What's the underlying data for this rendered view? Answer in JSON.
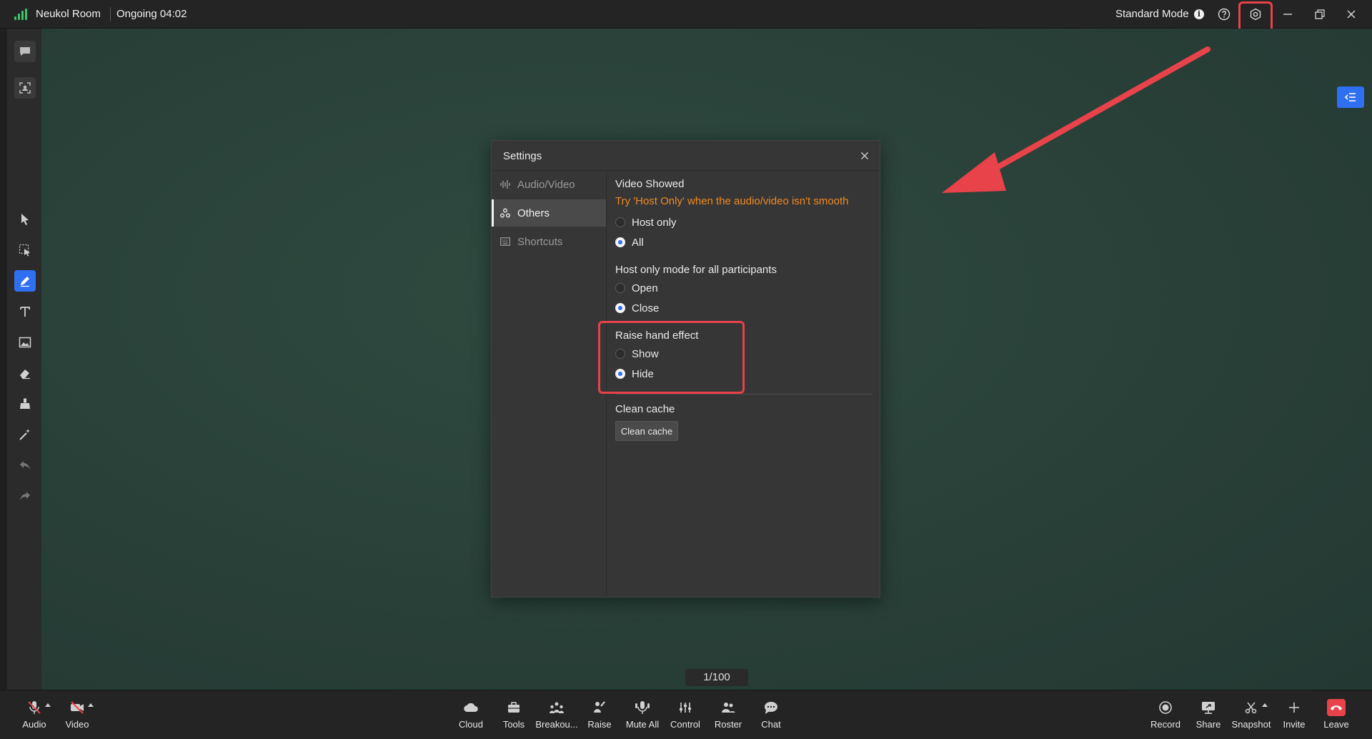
{
  "topbar": {
    "room_name": "Neukol Room",
    "status": "Ongoing 04:02",
    "mode": "Standard Mode",
    "mode_info_glyph": "i",
    "icons": [
      "signal-icon",
      "info-icon",
      "help-icon",
      "settings-icon",
      "minimize-icon",
      "restore-icon",
      "close-icon"
    ]
  },
  "left_toolbar": {
    "tools": [
      "chat-bubble-icon",
      "screenshot-icon",
      "select-arrow-icon",
      "area-select-icon",
      "pen-icon",
      "text-icon",
      "image-icon",
      "eraser-icon",
      "clear-brush-icon",
      "magic-wand-icon",
      "undo-icon",
      "redo-icon"
    ],
    "active_tool": "pen-icon"
  },
  "board": {
    "page_indicator": "1/100"
  },
  "dialog": {
    "title": "Settings",
    "nav": [
      {
        "label": "Audio/Video",
        "icon": "audio-wave-icon"
      },
      {
        "label": "Others",
        "icon": "others-icon"
      },
      {
        "label": "Shortcuts",
        "icon": "keyboard-icon"
      }
    ],
    "active_nav": "Others",
    "video_showed": {
      "title": "Video Showed",
      "hint": "Try 'Host Only' when the audio/video isn't smooth",
      "options": [
        "Host only",
        "All"
      ],
      "selected": "All"
    },
    "host_only_mode": {
      "title": "Host only mode for all participants",
      "options": [
        "Open",
        "Close"
      ],
      "selected": "Close"
    },
    "raise_hand_effect": {
      "title": "Raise hand effect",
      "options": [
        "Show",
        "Hide"
      ],
      "selected": "Hide"
    },
    "clean_cache": {
      "title": "Clean cache",
      "button_label": "Clean cache"
    }
  },
  "bottombar": {
    "left": [
      {
        "label": "Audio",
        "icon": "mic-muted-icon"
      },
      {
        "label": "Video",
        "icon": "camera-off-icon"
      }
    ],
    "center": [
      {
        "label": "Cloud",
        "icon": "cloud-icon"
      },
      {
        "label": "Tools",
        "icon": "toolbox-icon"
      },
      {
        "label": "Breakou...",
        "icon": "breakout-icon"
      },
      {
        "label": "Raise",
        "icon": "raise-hand-icon"
      },
      {
        "label": "Mute All",
        "icon": "mute-all-icon"
      },
      {
        "label": "Control",
        "icon": "control-icon"
      },
      {
        "label": "Roster",
        "icon": "roster-icon"
      },
      {
        "label": "Chat",
        "icon": "chat-icon"
      }
    ],
    "right": [
      {
        "label": "Record",
        "icon": "record-icon"
      },
      {
        "label": "Share",
        "icon": "share-screen-icon"
      },
      {
        "label": "Snapshot",
        "icon": "snapshot-icon"
      },
      {
        "label": "Invite",
        "icon": "invite-icon"
      },
      {
        "label": "Leave",
        "icon": "leave-icon"
      }
    ]
  },
  "colors": {
    "accent": "#2f6ff2",
    "highlight": "#e8424a",
    "hint": "#f08a24",
    "board": "#2a423a"
  }
}
